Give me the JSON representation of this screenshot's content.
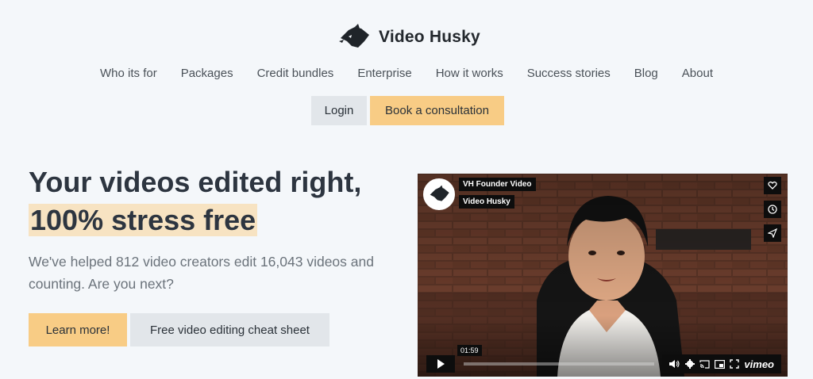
{
  "brand": {
    "name": "Video Husky"
  },
  "nav": {
    "items": [
      "Who its for",
      "Packages",
      "Credit bundles",
      "Enterprise",
      "How it works",
      "Success stories",
      "Blog",
      "About"
    ]
  },
  "header": {
    "login_label": "Login",
    "book_label": "Book a consultation"
  },
  "hero": {
    "title_line1": "Your videos edited right,",
    "title_line2": "100% stress free",
    "subtitle": "We've helped 812 video creators edit 16,043 videos and counting. Are you next?",
    "learn_label": "Learn more!",
    "cheat_label": "Free video editing cheat sheet"
  },
  "video": {
    "title": "VH Founder Video",
    "channel": "Video Husky",
    "duration": "01:59",
    "provider": "vimeo",
    "icons": [
      "heart-icon",
      "clock-icon",
      "send-icon",
      "play-icon",
      "volume-icon",
      "settings-icon",
      "cast-icon",
      "pip-icon",
      "fullscreen-icon"
    ]
  },
  "colors": {
    "accent": "#f8cc85",
    "secondary_button": "#e2e6ea",
    "highlight": "#f7e3c2",
    "background": "#f4f7fa"
  }
}
